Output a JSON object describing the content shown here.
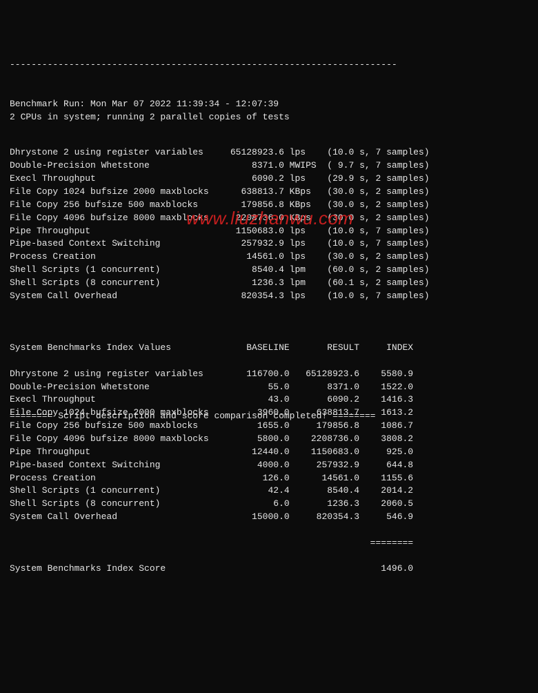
{
  "header": {
    "run_line": "Benchmark Run: Mon Mar 07 2022 11:39:34 - 12:07:39",
    "cpu_line": "2 CPUs in system; running 2 parallel copies of tests"
  },
  "tests": [
    {
      "name": "Dhrystone 2 using register variables",
      "value": "65128923.6",
      "unit": "lps",
      "time": "10.0 s",
      "samples": "7 samples"
    },
    {
      "name": "Double-Precision Whetstone",
      "value": "8371.0",
      "unit": "MWIPS",
      "time": "9.7 s",
      "samples": "7 samples"
    },
    {
      "name": "Execl Throughput",
      "value": "6090.2",
      "unit": "lps",
      "time": "29.9 s",
      "samples": "2 samples"
    },
    {
      "name": "File Copy 1024 bufsize 2000 maxblocks",
      "value": "638813.7",
      "unit": "KBps",
      "time": "30.0 s",
      "samples": "2 samples"
    },
    {
      "name": "File Copy 256 bufsize 500 maxblocks",
      "value": "179856.8",
      "unit": "KBps",
      "time": "30.0 s",
      "samples": "2 samples"
    },
    {
      "name": "File Copy 4096 bufsize 8000 maxblocks",
      "value": "2208736.0",
      "unit": "KBps",
      "time": "30.0 s",
      "samples": "2 samples"
    },
    {
      "name": "Pipe Throughput",
      "value": "1150683.0",
      "unit": "lps",
      "time": "10.0 s",
      "samples": "7 samples"
    },
    {
      "name": "Pipe-based Context Switching",
      "value": "257932.9",
      "unit": "lps",
      "time": "10.0 s",
      "samples": "7 samples"
    },
    {
      "name": "Process Creation",
      "value": "14561.0",
      "unit": "lps",
      "time": "30.0 s",
      "samples": "2 samples"
    },
    {
      "name": "Shell Scripts (1 concurrent)",
      "value": "8540.4",
      "unit": "lpm",
      "time": "60.0 s",
      "samples": "2 samples"
    },
    {
      "name": "Shell Scripts (8 concurrent)",
      "value": "1236.3",
      "unit": "lpm",
      "time": "60.1 s",
      "samples": "2 samples"
    },
    {
      "name": "System Call Overhead",
      "value": "820354.3",
      "unit": "lps",
      "time": "10.0 s",
      "samples": "7 samples"
    }
  ],
  "index_header": {
    "title": "System Benchmarks Index Values",
    "c1": "BASELINE",
    "c2": "RESULT",
    "c3": "INDEX"
  },
  "index_rows": [
    {
      "name": "Dhrystone 2 using register variables",
      "baseline": "116700.0",
      "result": "65128923.6",
      "index": "5580.9"
    },
    {
      "name": "Double-Precision Whetstone",
      "baseline": "55.0",
      "result": "8371.0",
      "index": "1522.0"
    },
    {
      "name": "Execl Throughput",
      "baseline": "43.0",
      "result": "6090.2",
      "index": "1416.3"
    },
    {
      "name": "File Copy 1024 bufsize 2000 maxblocks",
      "baseline": "3960.0",
      "result": "638813.7",
      "index": "1613.2"
    },
    {
      "name": "File Copy 256 bufsize 500 maxblocks",
      "baseline": "1655.0",
      "result": "179856.8",
      "index": "1086.7"
    },
    {
      "name": "File Copy 4096 bufsize 8000 maxblocks",
      "baseline": "5800.0",
      "result": "2208736.0",
      "index": "3808.2"
    },
    {
      "name": "Pipe Throughput",
      "baseline": "12440.0",
      "result": "1150683.0",
      "index": "925.0"
    },
    {
      "name": "Pipe-based Context Switching",
      "baseline": "4000.0",
      "result": "257932.9",
      "index": "644.8"
    },
    {
      "name": "Process Creation",
      "baseline": "126.0",
      "result": "14561.0",
      "index": "1155.6"
    },
    {
      "name": "Shell Scripts (1 concurrent)",
      "baseline": "42.4",
      "result": "8540.4",
      "index": "2014.2"
    },
    {
      "name": "Shell Scripts (8 concurrent)",
      "baseline": "6.0",
      "result": "1236.3",
      "index": "2060.5"
    },
    {
      "name": "System Call Overhead",
      "baseline": "15000.0",
      "result": "820354.3",
      "index": "546.9"
    }
  ],
  "score": {
    "label": "System Benchmarks Index Score",
    "value": "1496.0"
  },
  "divider": "========",
  "footer": "======== Script description and score comparison completed! ========",
  "watermark": "www.liuzhanwu.com"
}
